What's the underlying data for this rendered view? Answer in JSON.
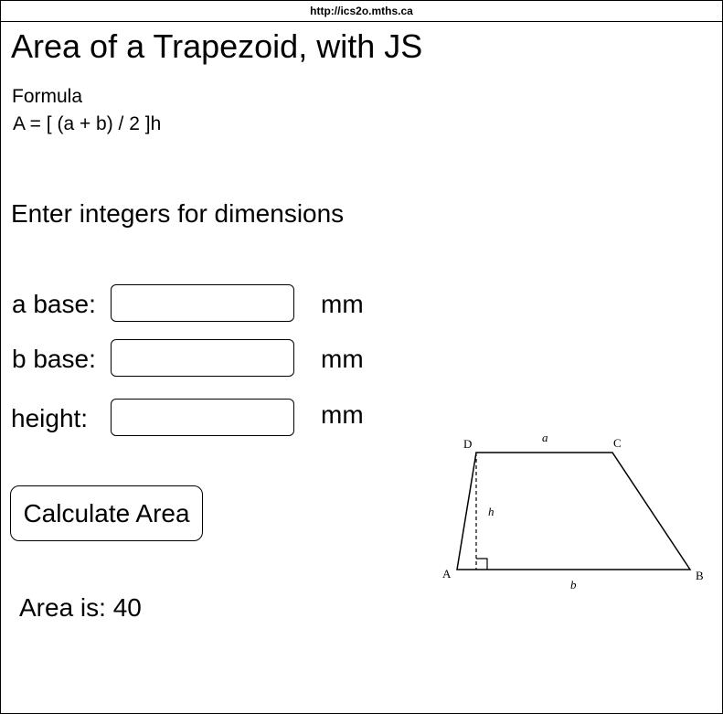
{
  "browser": {
    "url": "http://ics2o.mths.ca"
  },
  "page": {
    "title": "Area of a Trapezoid, with JS",
    "formula_label": "Formula",
    "formula": "A = [ (a + b) / 2 ]h",
    "instructions": "Enter integers for dimensions"
  },
  "form": {
    "a_base": {
      "label": "a base:",
      "value": "",
      "unit": "mm"
    },
    "b_base": {
      "label": "b base:",
      "value": "",
      "unit": "mm"
    },
    "height": {
      "label": "height:",
      "value": "",
      "unit": "mm"
    },
    "calculate_label": "Calculate Area"
  },
  "result": {
    "text": "Area is: 40"
  },
  "diagram": {
    "vertices": {
      "A": "A",
      "B": "B",
      "C": "C",
      "D": "D"
    },
    "sides": {
      "a": "a",
      "b": "b",
      "h": "h"
    }
  }
}
